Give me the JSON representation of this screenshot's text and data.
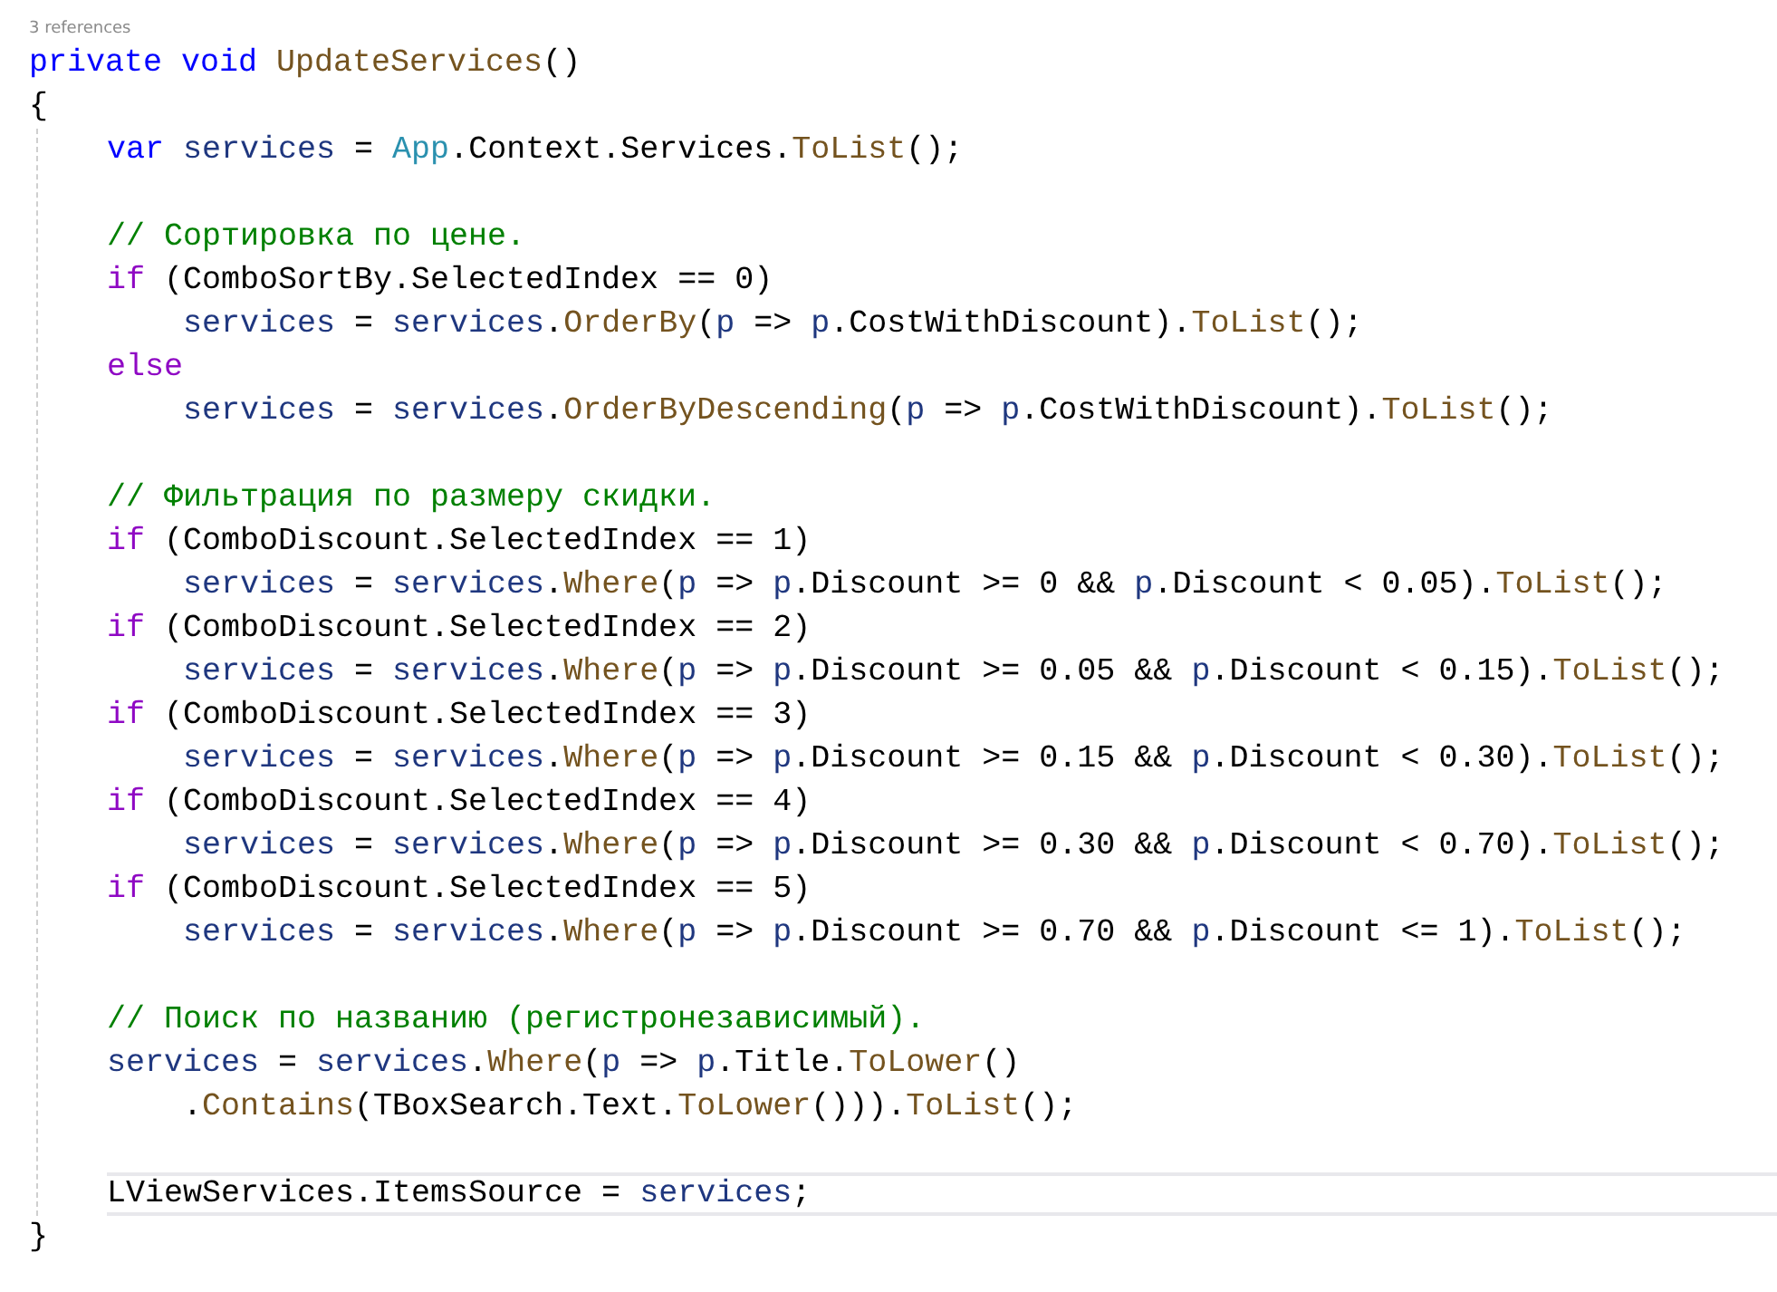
{
  "codelens": "3 references",
  "lines": [
    {
      "kind": "code",
      "current": false,
      "tokens": [
        {
          "kind": "keyword",
          "text": "private void "
        },
        {
          "kind": "method",
          "text": "UpdateServices"
        },
        {
          "kind": "plain",
          "text": "()"
        }
      ]
    },
    {
      "kind": "code",
      "current": false,
      "tokens": [
        {
          "kind": "plain",
          "text": "{"
        }
      ],
      "children": [
        {
          "kind": "code",
          "current": false,
          "tokens": [
            {
              "kind": "keyword",
              "text": "var "
            },
            {
              "kind": "local",
              "text": "services"
            },
            {
              "kind": "plain",
              "text": " = "
            },
            {
              "kind": "type",
              "text": "App"
            },
            {
              "kind": "plain",
              "text": ".Context.Services."
            },
            {
              "kind": "method",
              "text": "ToList"
            },
            {
              "kind": "plain",
              "text": "();"
            }
          ]
        },
        {
          "kind": "blank",
          "current": false
        },
        {
          "kind": "code",
          "current": false,
          "tokens": [
            {
              "kind": "comment",
              "text": "// Сортировка по цене."
            }
          ]
        },
        {
          "kind": "code",
          "current": false,
          "tokens": [
            {
              "kind": "control",
              "text": "if"
            },
            {
              "kind": "plain",
              "text": " (ComboSortBy.SelectedIndex == 0)"
            }
          ],
          "children": [
            {
              "kind": "code",
              "current": false,
              "tokens": [
                {
                  "kind": "local",
                  "text": "services"
                },
                {
                  "kind": "plain",
                  "text": " = "
                },
                {
                  "kind": "local",
                  "text": "services"
                },
                {
                  "kind": "plain",
                  "text": "."
                },
                {
                  "kind": "method",
                  "text": "OrderBy"
                },
                {
                  "kind": "plain",
                  "text": "("
                },
                {
                  "kind": "local",
                  "text": "p"
                },
                {
                  "kind": "plain",
                  "text": " => "
                },
                {
                  "kind": "local",
                  "text": "p"
                },
                {
                  "kind": "plain",
                  "text": ".CostWithDiscount)."
                },
                {
                  "kind": "method",
                  "text": "ToList"
                },
                {
                  "kind": "plain",
                  "text": "();"
                }
              ]
            }
          ]
        },
        {
          "kind": "code",
          "current": false,
          "tokens": [
            {
              "kind": "control",
              "text": "else"
            }
          ],
          "children": [
            {
              "kind": "code",
              "current": false,
              "tokens": [
                {
                  "kind": "local",
                  "text": "services"
                },
                {
                  "kind": "plain",
                  "text": " = "
                },
                {
                  "kind": "local",
                  "text": "services"
                },
                {
                  "kind": "plain",
                  "text": "."
                },
                {
                  "kind": "method",
                  "text": "OrderByDescending"
                },
                {
                  "kind": "plain",
                  "text": "("
                },
                {
                  "kind": "local",
                  "text": "p"
                },
                {
                  "kind": "plain",
                  "text": " => "
                },
                {
                  "kind": "local",
                  "text": "p"
                },
                {
                  "kind": "plain",
                  "text": ".CostWithDiscount)."
                },
                {
                  "kind": "method",
                  "text": "ToList"
                },
                {
                  "kind": "plain",
                  "text": "();"
                }
              ]
            }
          ]
        },
        {
          "kind": "blank",
          "current": false
        },
        {
          "kind": "code",
          "current": false,
          "tokens": [
            {
              "kind": "comment",
              "text": "// Фильтрация по размеру скидки."
            }
          ]
        },
        {
          "kind": "code",
          "current": false,
          "tokens": [
            {
              "kind": "control",
              "text": "if"
            },
            {
              "kind": "plain",
              "text": " (ComboDiscount.SelectedIndex == 1)"
            }
          ],
          "children": [
            {
              "kind": "code",
              "current": false,
              "tokens": [
                {
                  "kind": "local",
                  "text": "services"
                },
                {
                  "kind": "plain",
                  "text": " = "
                },
                {
                  "kind": "local",
                  "text": "services"
                },
                {
                  "kind": "plain",
                  "text": "."
                },
                {
                  "kind": "method",
                  "text": "Where"
                },
                {
                  "kind": "plain",
                  "text": "("
                },
                {
                  "kind": "local",
                  "text": "p"
                },
                {
                  "kind": "plain",
                  "text": " => "
                },
                {
                  "kind": "local",
                  "text": "p"
                },
                {
                  "kind": "plain",
                  "text": ".Discount >= 0 && "
                },
                {
                  "kind": "local",
                  "text": "p"
                },
                {
                  "kind": "plain",
                  "text": ".Discount < 0.05)."
                },
                {
                  "kind": "method",
                  "text": "ToList"
                },
                {
                  "kind": "plain",
                  "text": "();"
                }
              ]
            }
          ]
        },
        {
          "kind": "code",
          "current": false,
          "tokens": [
            {
              "kind": "control",
              "text": "if"
            },
            {
              "kind": "plain",
              "text": " (ComboDiscount.SelectedIndex == 2)"
            }
          ],
          "children": [
            {
              "kind": "code",
              "current": false,
              "tokens": [
                {
                  "kind": "local",
                  "text": "services"
                },
                {
                  "kind": "plain",
                  "text": " = "
                },
                {
                  "kind": "local",
                  "text": "services"
                },
                {
                  "kind": "plain",
                  "text": "."
                },
                {
                  "kind": "method",
                  "text": "Where"
                },
                {
                  "kind": "plain",
                  "text": "("
                },
                {
                  "kind": "local",
                  "text": "p"
                },
                {
                  "kind": "plain",
                  "text": " => "
                },
                {
                  "kind": "local",
                  "text": "p"
                },
                {
                  "kind": "plain",
                  "text": ".Discount >= 0.05 && "
                },
                {
                  "kind": "local",
                  "text": "p"
                },
                {
                  "kind": "plain",
                  "text": ".Discount < 0.15)."
                },
                {
                  "kind": "method",
                  "text": "ToList"
                },
                {
                  "kind": "plain",
                  "text": "();"
                }
              ]
            }
          ]
        },
        {
          "kind": "code",
          "current": false,
          "tokens": [
            {
              "kind": "control",
              "text": "if"
            },
            {
              "kind": "plain",
              "text": " (ComboDiscount.SelectedIndex == 3)"
            }
          ],
          "children": [
            {
              "kind": "code",
              "current": false,
              "tokens": [
                {
                  "kind": "local",
                  "text": "services"
                },
                {
                  "kind": "plain",
                  "text": " = "
                },
                {
                  "kind": "local",
                  "text": "services"
                },
                {
                  "kind": "plain",
                  "text": "."
                },
                {
                  "kind": "method",
                  "text": "Where"
                },
                {
                  "kind": "plain",
                  "text": "("
                },
                {
                  "kind": "local",
                  "text": "p"
                },
                {
                  "kind": "plain",
                  "text": " => "
                },
                {
                  "kind": "local",
                  "text": "p"
                },
                {
                  "kind": "plain",
                  "text": ".Discount >= 0.15 && "
                },
                {
                  "kind": "local",
                  "text": "p"
                },
                {
                  "kind": "plain",
                  "text": ".Discount < 0.30)."
                },
                {
                  "kind": "method",
                  "text": "ToList"
                },
                {
                  "kind": "plain",
                  "text": "();"
                }
              ]
            }
          ]
        },
        {
          "kind": "code",
          "current": false,
          "tokens": [
            {
              "kind": "control",
              "text": "if"
            },
            {
              "kind": "plain",
              "text": " (ComboDiscount.SelectedIndex == 4)"
            }
          ],
          "children": [
            {
              "kind": "code",
              "current": false,
              "tokens": [
                {
                  "kind": "local",
                  "text": "services"
                },
                {
                  "kind": "plain",
                  "text": " = "
                },
                {
                  "kind": "local",
                  "text": "services"
                },
                {
                  "kind": "plain",
                  "text": "."
                },
                {
                  "kind": "method",
                  "text": "Where"
                },
                {
                  "kind": "plain",
                  "text": "("
                },
                {
                  "kind": "local",
                  "text": "p"
                },
                {
                  "kind": "plain",
                  "text": " => "
                },
                {
                  "kind": "local",
                  "text": "p"
                },
                {
                  "kind": "plain",
                  "text": ".Discount >= 0.30 && "
                },
                {
                  "kind": "local",
                  "text": "p"
                },
                {
                  "kind": "plain",
                  "text": ".Discount < 0.70)."
                },
                {
                  "kind": "method",
                  "text": "ToList"
                },
                {
                  "kind": "plain",
                  "text": "();"
                }
              ]
            }
          ]
        },
        {
          "kind": "code",
          "current": false,
          "tokens": [
            {
              "kind": "control",
              "text": "if"
            },
            {
              "kind": "plain",
              "text": " (ComboDiscount.SelectedIndex == 5)"
            }
          ],
          "children": [
            {
              "kind": "code",
              "current": false,
              "tokens": [
                {
                  "kind": "local",
                  "text": "services"
                },
                {
                  "kind": "plain",
                  "text": " = "
                },
                {
                  "kind": "local",
                  "text": "services"
                },
                {
                  "kind": "plain",
                  "text": "."
                },
                {
                  "kind": "method",
                  "text": "Where"
                },
                {
                  "kind": "plain",
                  "text": "("
                },
                {
                  "kind": "local",
                  "text": "p"
                },
                {
                  "kind": "plain",
                  "text": " => "
                },
                {
                  "kind": "local",
                  "text": "p"
                },
                {
                  "kind": "plain",
                  "text": ".Discount >= 0.70 && "
                },
                {
                  "kind": "local",
                  "text": "p"
                },
                {
                  "kind": "plain",
                  "text": ".Discount <= 1)."
                },
                {
                  "kind": "method",
                  "text": "ToList"
                },
                {
                  "kind": "plain",
                  "text": "();"
                }
              ]
            }
          ]
        },
        {
          "kind": "blank",
          "current": false
        },
        {
          "kind": "code",
          "current": false,
          "tokens": [
            {
              "kind": "comment",
              "text": "// Поиск по названию (регистронезависимый)."
            }
          ]
        },
        {
          "kind": "code",
          "current": false,
          "tokens": [
            {
              "kind": "local",
              "text": "services"
            },
            {
              "kind": "plain",
              "text": " = "
            },
            {
              "kind": "local",
              "text": "services"
            },
            {
              "kind": "plain",
              "text": "."
            },
            {
              "kind": "method",
              "text": "Where"
            },
            {
              "kind": "plain",
              "text": "("
            },
            {
              "kind": "local",
              "text": "p"
            },
            {
              "kind": "plain",
              "text": " => "
            },
            {
              "kind": "local",
              "text": "p"
            },
            {
              "kind": "plain",
              "text": ".Title."
            },
            {
              "kind": "method",
              "text": "ToLower"
            },
            {
              "kind": "plain",
              "text": "()"
            }
          ],
          "children": [
            {
              "kind": "code",
              "current": false,
              "tokens": [
                {
                  "kind": "plain",
                  "text": "."
                },
                {
                  "kind": "method",
                  "text": "Contains"
                },
                {
                  "kind": "plain",
                  "text": "(TBoxSearch.Text."
                },
                {
                  "kind": "method",
                  "text": "ToLower"
                },
                {
                  "kind": "plain",
                  "text": "()))."
                },
                {
                  "kind": "method",
                  "text": "ToList"
                },
                {
                  "kind": "plain",
                  "text": "();"
                }
              ]
            }
          ]
        },
        {
          "kind": "blank",
          "current": false
        },
        {
          "kind": "code",
          "current": true,
          "tokens": [
            {
              "kind": "plain",
              "text": "LViewServices.ItemsSource = "
            },
            {
              "kind": "local",
              "text": "services"
            },
            {
              "kind": "plain",
              "text": ";"
            }
          ]
        }
      ]
    },
    {
      "kind": "code",
      "current": false,
      "tokens": [
        {
          "kind": "plain",
          "text": "}"
        }
      ]
    }
  ]
}
